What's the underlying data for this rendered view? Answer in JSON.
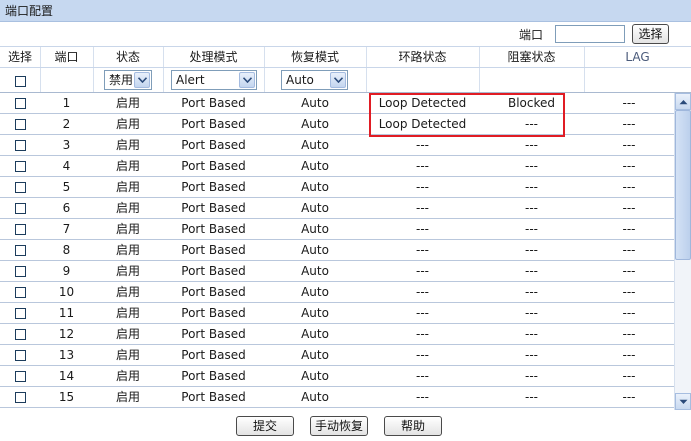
{
  "title": "端口配置",
  "search": {
    "label": "端口",
    "value": "",
    "button": "选择"
  },
  "columns": [
    "选择",
    "端口",
    "状态",
    "处理模式",
    "恢复模式",
    "环路状态",
    "阻塞状态",
    "LAG"
  ],
  "filters": {
    "status": "禁用",
    "process_mode": "Alert",
    "recovery_mode": "Auto"
  },
  "rows": [
    {
      "port": "1",
      "status": "启用",
      "process_mode": "Port Based",
      "recovery_mode": "Auto",
      "loop_status": "Loop Detected",
      "block_status": "Blocked",
      "lag": "---"
    },
    {
      "port": "2",
      "status": "启用",
      "process_mode": "Port Based",
      "recovery_mode": "Auto",
      "loop_status": "Loop Detected",
      "block_status": "---",
      "lag": "---"
    },
    {
      "port": "3",
      "status": "启用",
      "process_mode": "Port Based",
      "recovery_mode": "Auto",
      "loop_status": "---",
      "block_status": "---",
      "lag": "---"
    },
    {
      "port": "4",
      "status": "启用",
      "process_mode": "Port Based",
      "recovery_mode": "Auto",
      "loop_status": "---",
      "block_status": "---",
      "lag": "---"
    },
    {
      "port": "5",
      "status": "启用",
      "process_mode": "Port Based",
      "recovery_mode": "Auto",
      "loop_status": "---",
      "block_status": "---",
      "lag": "---"
    },
    {
      "port": "6",
      "status": "启用",
      "process_mode": "Port Based",
      "recovery_mode": "Auto",
      "loop_status": "---",
      "block_status": "---",
      "lag": "---"
    },
    {
      "port": "7",
      "status": "启用",
      "process_mode": "Port Based",
      "recovery_mode": "Auto",
      "loop_status": "---",
      "block_status": "---",
      "lag": "---"
    },
    {
      "port": "8",
      "status": "启用",
      "process_mode": "Port Based",
      "recovery_mode": "Auto",
      "loop_status": "---",
      "block_status": "---",
      "lag": "---"
    },
    {
      "port": "9",
      "status": "启用",
      "process_mode": "Port Based",
      "recovery_mode": "Auto",
      "loop_status": "---",
      "block_status": "---",
      "lag": "---"
    },
    {
      "port": "10",
      "status": "启用",
      "process_mode": "Port Based",
      "recovery_mode": "Auto",
      "loop_status": "---",
      "block_status": "---",
      "lag": "---"
    },
    {
      "port": "11",
      "status": "启用",
      "process_mode": "Port Based",
      "recovery_mode": "Auto",
      "loop_status": "---",
      "block_status": "---",
      "lag": "---"
    },
    {
      "port": "12",
      "status": "启用",
      "process_mode": "Port Based",
      "recovery_mode": "Auto",
      "loop_status": "---",
      "block_status": "---",
      "lag": "---"
    },
    {
      "port": "13",
      "status": "启用",
      "process_mode": "Port Based",
      "recovery_mode": "Auto",
      "loop_status": "---",
      "block_status": "---",
      "lag": "---"
    },
    {
      "port": "14",
      "status": "启用",
      "process_mode": "Port Based",
      "recovery_mode": "Auto",
      "loop_status": "---",
      "block_status": "---",
      "lag": "---"
    },
    {
      "port": "15",
      "status": "启用",
      "process_mode": "Port Based",
      "recovery_mode": "Auto",
      "loop_status": "---",
      "block_status": "---",
      "lag": "---"
    }
  ],
  "buttons": {
    "submit": "提交",
    "manual_recover": "手动恢复",
    "help": "帮助"
  },
  "colors": {
    "title_bg": "#c6d8f0",
    "highlight": "#e01c24",
    "row_divider": "#b9c7dc"
  },
  "icons": {
    "dropdown": "chevron-down-icon",
    "scroll_up": "scroll-up-icon",
    "scroll_down": "scroll-down-icon"
  }
}
